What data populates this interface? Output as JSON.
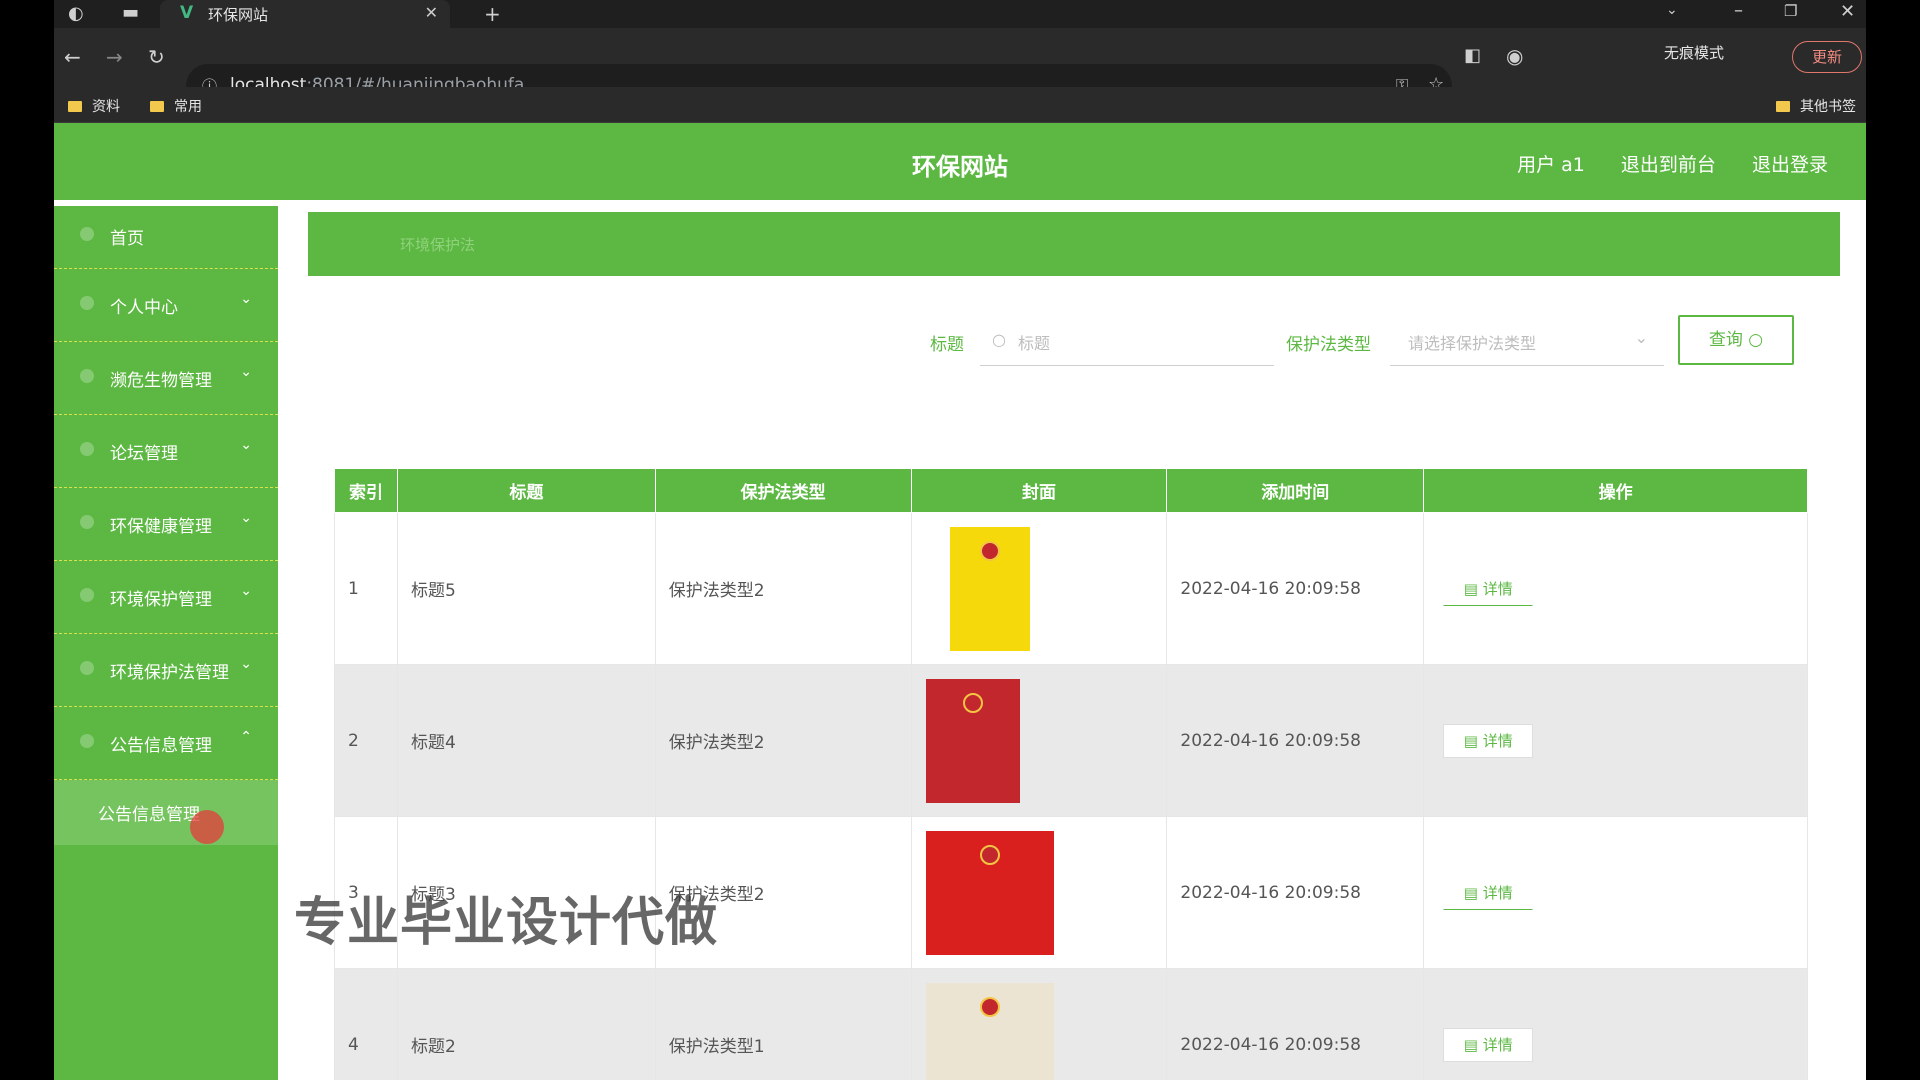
{
  "browser": {
    "tab_title": "环保网站",
    "url_host": "localhost",
    "url_rest": ":8081/#/huanjingbaohufa",
    "incognito_label": "无痕模式",
    "update_label": "更新",
    "bookmarks": [
      "资料",
      "常用"
    ],
    "other_bookmarks": "其他书签"
  },
  "header": {
    "site_title": "环保网站",
    "user_label": "用户 a1",
    "front_link": "退出到前台",
    "logout_link": "退出登录"
  },
  "sidebar": {
    "items": [
      {
        "label": "首页",
        "chevron": ""
      },
      {
        "label": "个人中心",
        "chevron": "⌄"
      },
      {
        "label": "濒危生物管理",
        "chevron": "⌄"
      },
      {
        "label": "论坛管理",
        "chevron": "⌄"
      },
      {
        "label": "环保健康管理",
        "chevron": "⌄"
      },
      {
        "label": "环境保护管理",
        "chevron": "⌄"
      },
      {
        "label": "环境保护法管理",
        "chevron": "⌄"
      },
      {
        "label": "公告信息管理",
        "chevron": "⌃"
      }
    ],
    "sub_item": "公告信息管理"
  },
  "breadcrumb": "环境保护法",
  "filters": {
    "title_label": "标题",
    "title_placeholder": "标题",
    "type_label": "保护法类型",
    "type_placeholder": "请选择保护法类型",
    "query_label": "查询"
  },
  "table": {
    "headers": [
      "索引",
      "标题",
      "保护法类型",
      "封面",
      "添加时间",
      "操作"
    ],
    "rows": [
      {
        "index": "1",
        "title": "标题5",
        "type": "保护法类型2",
        "time": "2022-04-16 20:09:58",
        "action": "详情",
        "cover_color": "#f5d90a"
      },
      {
        "index": "2",
        "title": "标题4",
        "type": "保护法类型2",
        "time": "2022-04-16 20:09:58",
        "action": "详情",
        "cover_color": "#c1272d"
      },
      {
        "index": "3",
        "title": "标题3",
        "type": "保护法类型2",
        "time": "2022-04-16 20:09:58",
        "action": "详情",
        "cover_color": "#d9201f"
      },
      {
        "index": "4",
        "title": "标题2",
        "type": "保护法类型1",
        "time": "2022-04-16 20:09:58",
        "action": "详情",
        "cover_color": "#ece4d2"
      }
    ]
  },
  "watermark": "专业毕业设计代做",
  "colors": {
    "accent": "#5cb843",
    "sidebar_sub": "#76c45f"
  }
}
